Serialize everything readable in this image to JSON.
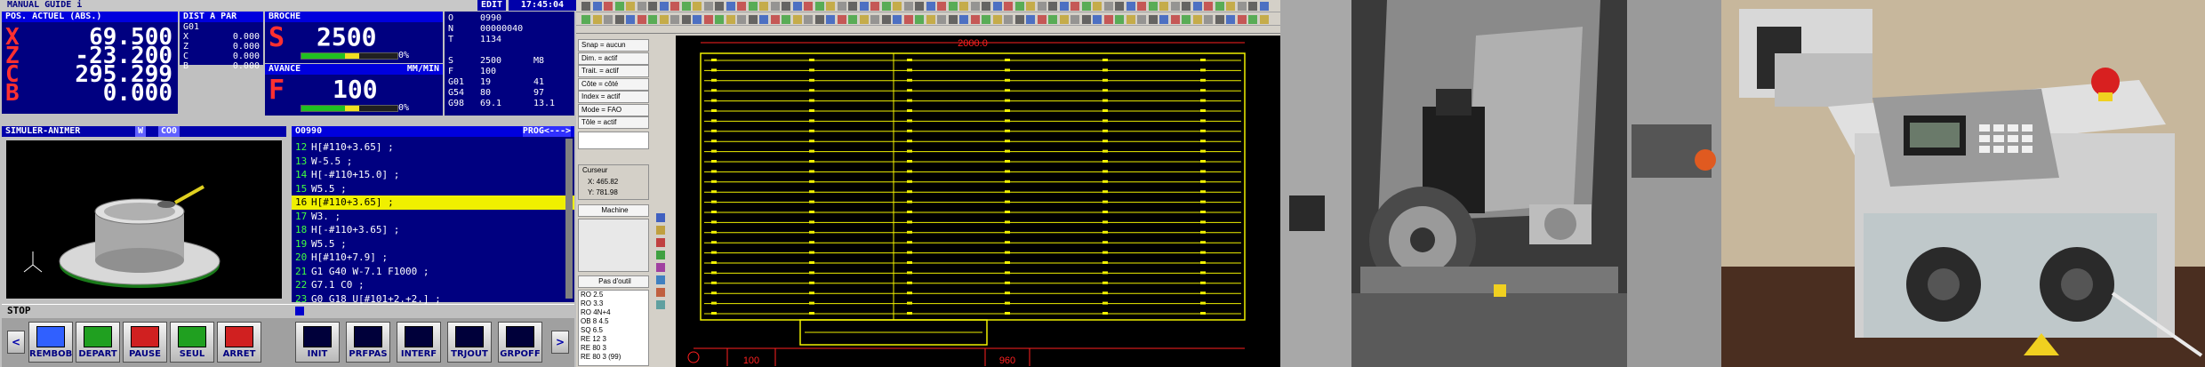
{
  "cnc": {
    "mode": "MANUAL GUIDE i",
    "edit_flag": "EDIT",
    "clock": "17:45:04",
    "position": {
      "title": "POS. ACTUEL (ABS.)",
      "axes": [
        {
          "axis": "X",
          "value": "69.500"
        },
        {
          "axis": "Z",
          "value": "-23.200"
        },
        {
          "axis": "C",
          "value": "295.299"
        },
        {
          "axis": "B",
          "value": "0.000"
        }
      ]
    },
    "distance": {
      "title": "DIST A PAR",
      "code": "G01",
      "rows": [
        {
          "axis": "X",
          "value": "0.000"
        },
        {
          "axis": "Z",
          "value": "0.000"
        },
        {
          "axis": "C",
          "value": "0.000"
        },
        {
          "axis": "B",
          "value": "0.000"
        }
      ]
    },
    "spindle": {
      "title": "BROCHE",
      "letter": "S",
      "value": "2500",
      "load_pct": "0%",
      "load_fraction": 0.0
    },
    "feed": {
      "title": "AVANCE",
      "unit": "MM/MIN",
      "letter": "F",
      "value": "100",
      "load_pct": "0%",
      "load_fraction": 0.0
    },
    "modal": {
      "rows": [
        {
          "a": "O",
          "b": "0990"
        },
        {
          "a": "N",
          "b": "00000040"
        },
        {
          "a": "T",
          "b": "1134"
        }
      ],
      "s_line": {
        "a": "S",
        "b": "2500",
        "c": "M8"
      },
      "f_line": {
        "a": "F",
        "b": "100"
      },
      "g_rows": [
        {
          "a": "G01",
          "b": "19",
          "c": "41"
        },
        {
          "a": "G54",
          "b": "80",
          "c": "97"
        },
        {
          "a": "G98",
          "b": "69.1",
          "c": "13.1"
        }
      ]
    },
    "sim": {
      "title": "SIMULER-ANIMER",
      "tag1": "W",
      "tag2": "CO0"
    },
    "program": {
      "name": "O0990",
      "tag": "PROG<--->",
      "current_line": 16,
      "lines": [
        {
          "n": "12",
          "code": "H[#110+3.65] ;"
        },
        {
          "n": "13",
          "code": "W-5.5 ;"
        },
        {
          "n": "14",
          "code": "H[-#110+15.0] ;"
        },
        {
          "n": "15",
          "code": "W5.5 ;"
        },
        {
          "n": "16",
          "code": "H[#110+3.65] ;"
        },
        {
          "n": "17",
          "code": "W3. ;"
        },
        {
          "n": "18",
          "code": "H[-#110+3.65] ;"
        },
        {
          "n": "19",
          "code": "W5.5 ;"
        },
        {
          "n": "20",
          "code": "H[#110+7.9] ;"
        },
        {
          "n": "21",
          "code": "G1 G40 W-7.1 F1000 ;"
        },
        {
          "n": "22",
          "code": "G7.1 C0 ;"
        },
        {
          "n": "23",
          "code": "G0 G18 U[#101+2.+2.] ;"
        }
      ]
    },
    "status": "STOP",
    "softkeys_left": [
      "REMBOB",
      "DEPART",
      "PAUSE",
      "SEUL",
      "ARRET"
    ],
    "softkeys_right": [
      "INIT",
      "PRFPAS",
      "INTERF",
      "TRJOUT",
      "GRPOFF"
    ]
  },
  "cad": {
    "side_buttons": [
      "Snap = aucun",
      "Dim. = actif",
      "Trait. = actif",
      "Côte = côté",
      "Index = actif",
      "Mode = FAO",
      "Tôle = actif"
    ],
    "cursor_title": "Curseur",
    "cursor_x": "X: 465.82",
    "cursor_y": "Y: 781.98",
    "machine_label": "Machine",
    "tool_step_label": "Pas d'outil",
    "tool_list": [
      "RO 2.5",
      "RO 3.3",
      "RO 4N+4",
      "OB 8 4.5",
      "SQ 6.5",
      "RE 12 3",
      "RE 80 3",
      "RE 80 3 (99)"
    ],
    "dim_top": "2000.0",
    "dim_bottom_left": "100",
    "dim_bottom_right": "960",
    "colors": {
      "sheet": "#f0f000",
      "dimension": "#ff2020",
      "background": "#000000"
    }
  },
  "photos": {
    "lathe": {
      "label_sticker": "",
      "desc_icon": "photo-cnc-lathe"
    },
    "stripper": {
      "desc_icon": "photo-cable-stripping-machine"
    }
  }
}
